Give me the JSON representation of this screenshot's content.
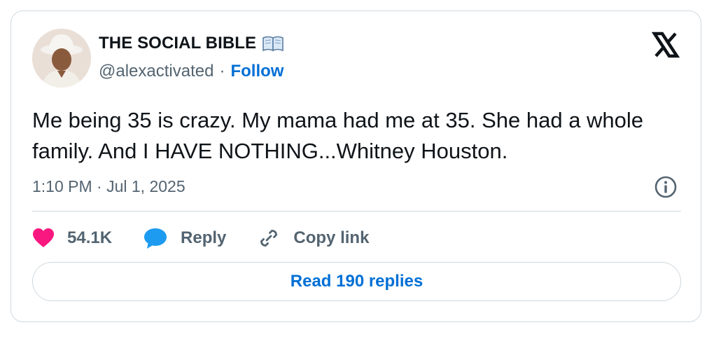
{
  "author": {
    "name": "THE SOCIAL BIBLE",
    "handle": "@alexactivated",
    "separator": "·",
    "follow_label": "Follow"
  },
  "tweet": {
    "text": "Me being 35 is crazy. My mama had me at 35. She had a whole family. And I HAVE NOTHING...Whitney Houston.",
    "timestamp": "1:10 PM · Jul 1, 2025"
  },
  "actions": {
    "likes": "54.1K",
    "reply_label": "Reply",
    "copy_label": "Copy link"
  },
  "footer": {
    "read_replies_label": "Read 190 replies"
  },
  "icons": {
    "like": "heart-icon",
    "reply": "speech-bubble-icon",
    "copy": "link-icon",
    "brand": "x-logo-icon",
    "info": "info-icon",
    "badge": "open-book-icon"
  },
  "colors": {
    "like": "#f91880",
    "reply": "#1d9bf0",
    "link": "#006fd6",
    "muted": "#536471",
    "border": "#cfd9de"
  }
}
